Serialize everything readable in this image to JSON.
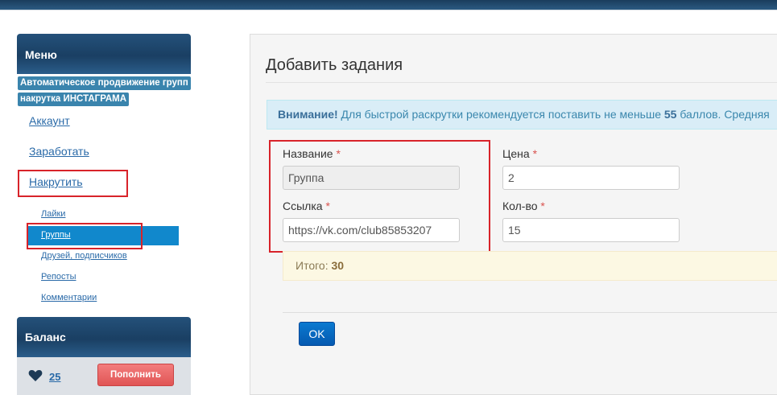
{
  "sidebar": {
    "menu_title": "Меню",
    "promo": [
      "Автоматическое продвижение групп",
      "накрутка ИНСТАГРАМА"
    ],
    "nav": {
      "account": "Аккаунт",
      "earn": "Заработать",
      "boost": "Накрутить"
    },
    "sub": {
      "likes": "Лайки",
      "groups": "Группы",
      "friends": "Друзей, подписчиков",
      "reposts": "Репосты",
      "comments": "Комментарии"
    },
    "balance": {
      "title": "Баланс",
      "value": "25",
      "topup_label": "Пополнить"
    }
  },
  "main": {
    "title": "Добавить задания",
    "alert": {
      "strong": "Внимание!",
      "text_before": " Для быстрой раскрутки рекомендуется поставить не меньше ",
      "min_points": "55",
      "text_after": " баллов. Средняя"
    },
    "form": {
      "required_mark": "*",
      "name_label": "Название",
      "name_value": "Группа",
      "link_label": "Ссылка",
      "link_value": "https://vk.com/club85853207",
      "price_label": "Цена",
      "price_value": "2",
      "qty_label": "Кол-во",
      "qty_value": "15",
      "total_label": "Итого:",
      "total_value": "30",
      "ok_label": "OK"
    }
  },
  "colors": {
    "header_blue": "#1a3f63",
    "link_blue": "#2a6aa8",
    "active_blue": "#1188cc",
    "highlight_red": "#d8232a",
    "topup_red": "#e05555",
    "ok_blue": "#0a6ac0"
  }
}
